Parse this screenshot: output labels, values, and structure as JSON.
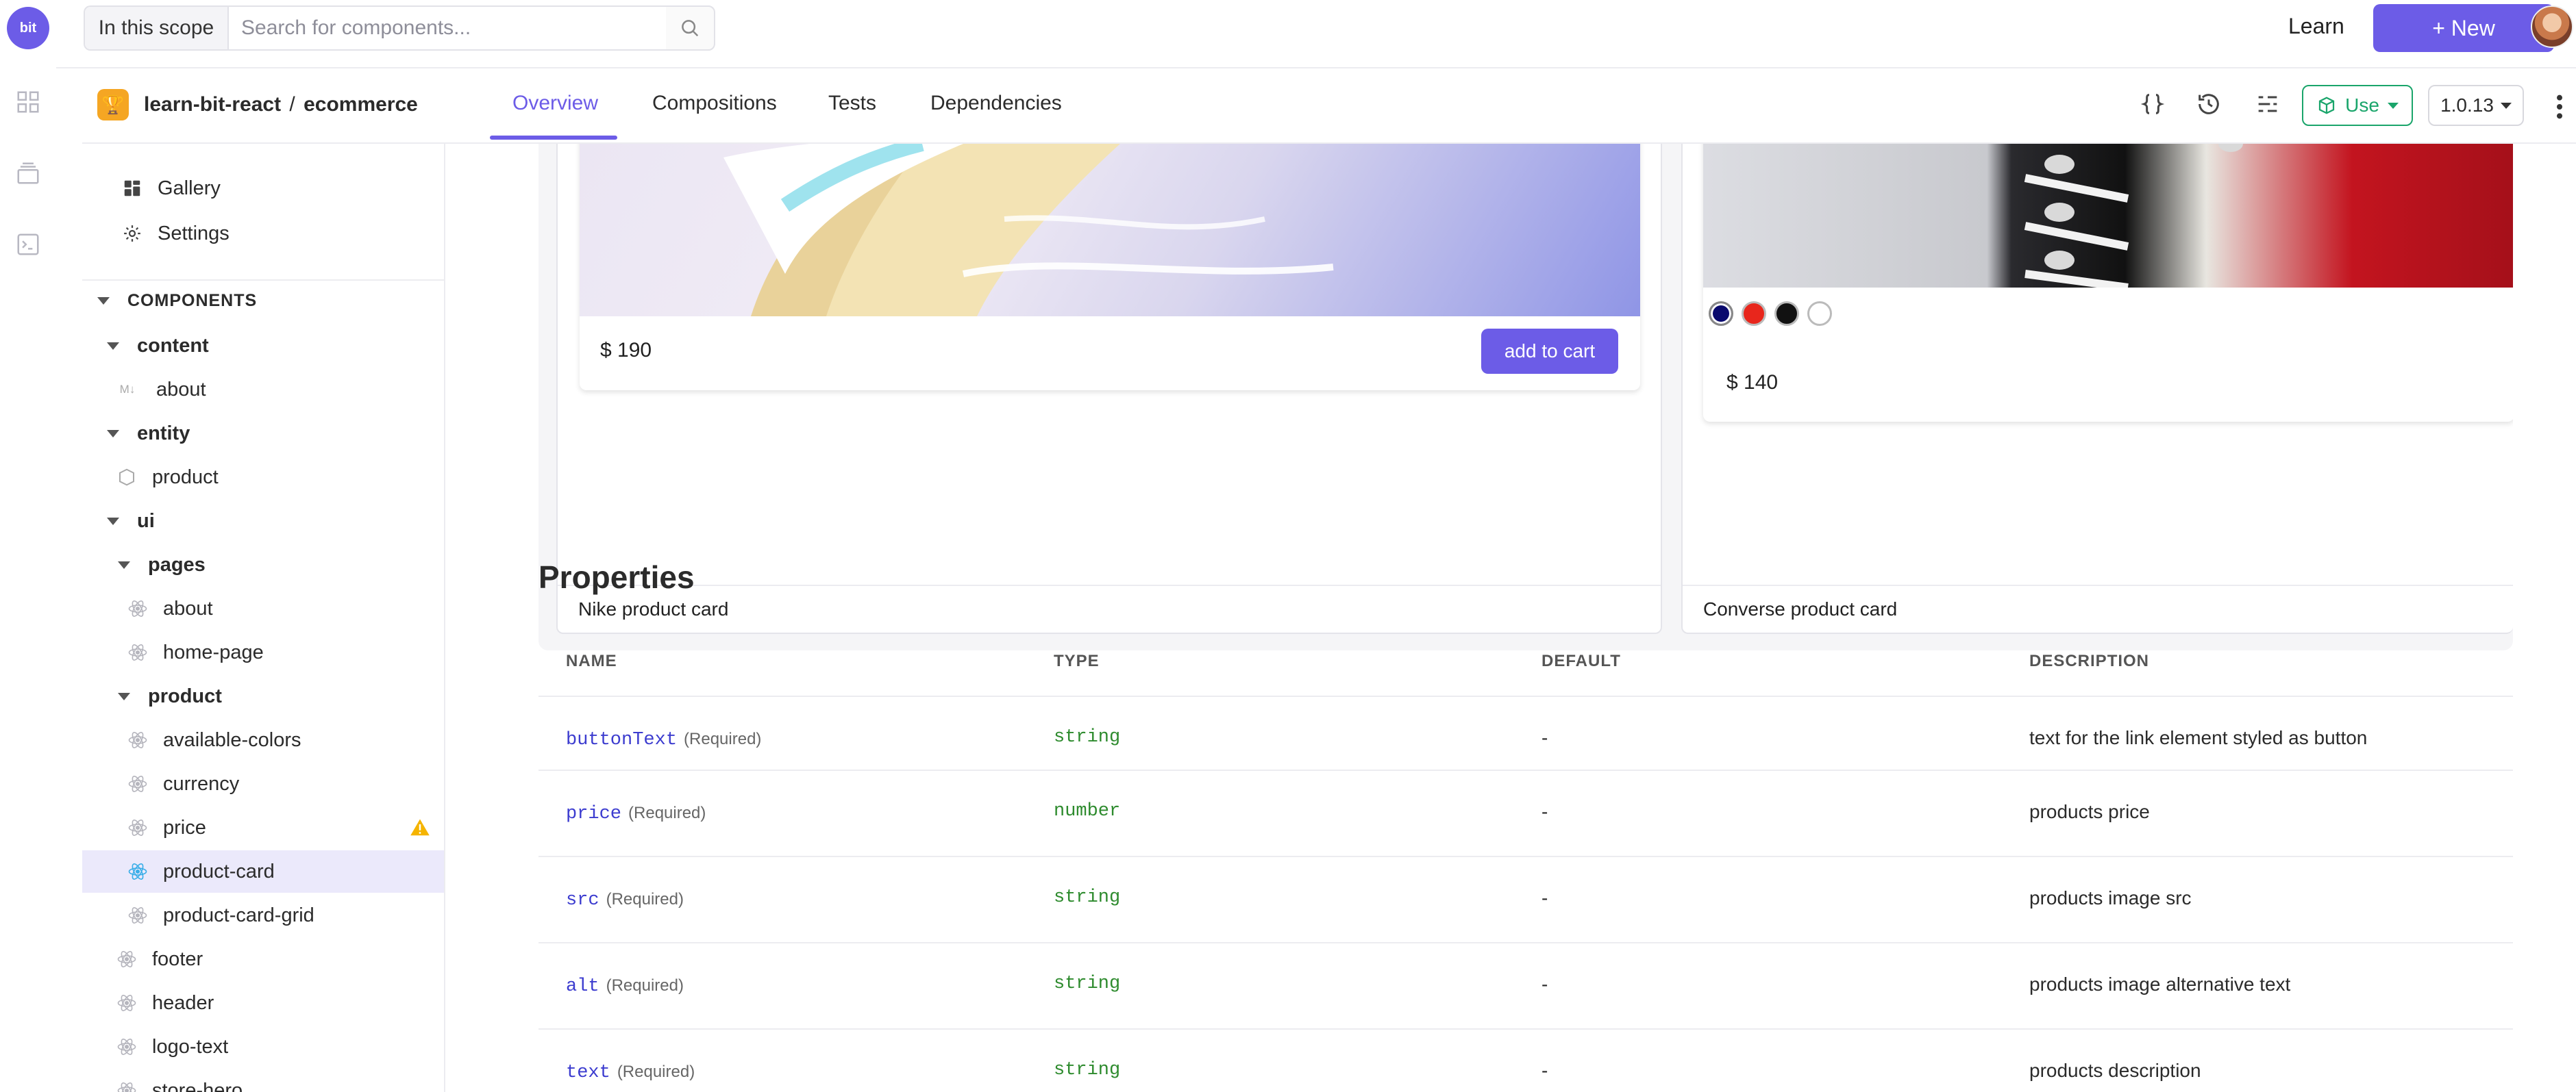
{
  "rail": {
    "logo": "bit"
  },
  "topbar": {
    "scope_label": "In this scope",
    "search_placeholder": "Search for components...",
    "learn": "Learn",
    "new_button": "+ New"
  },
  "component": {
    "scope": "learn-bit-react",
    "separator": "/",
    "name": "ecommerce",
    "tabs": [
      "Overview",
      "Compositions",
      "Tests",
      "Dependencies"
    ],
    "active_tab": "Overview",
    "use_button": "Use",
    "version": "1.0.13"
  },
  "sidebar": {
    "gallery": "Gallery",
    "settings": "Settings",
    "components_header": "COMPONENTS",
    "tree": {
      "content": "content",
      "about_md": "about",
      "entity": "entity",
      "product_entity": "product",
      "ui": "ui",
      "pages": "pages",
      "pages_about": "about",
      "home_page": "home-page",
      "product_ns": "product",
      "available_colors": "available-colors",
      "currency": "currency",
      "price": "price",
      "product_card": "product-card",
      "product_card_grid": "product-card-grid",
      "footer": "footer",
      "header": "header",
      "logo_text": "logo-text",
      "store_hero": "store-hero"
    }
  },
  "compositions": {
    "nike": {
      "price": "$ 190",
      "button": "add to cart",
      "caption": "Nike product card"
    },
    "converse": {
      "price": "$ 140",
      "caption": "Converse product card",
      "swatches": [
        "#0a0a6e",
        "#e8261c",
        "#111111",
        "#ffffff"
      ]
    }
  },
  "properties": {
    "title": "Properties",
    "headers": {
      "name": "NAME",
      "type": "TYPE",
      "default": "DEFAULT",
      "description": "DESCRIPTION"
    },
    "rows": [
      {
        "name": "buttonText",
        "required": "(Required)",
        "type": "string",
        "default": "-",
        "description": "text for the link element styled as button"
      },
      {
        "name": "price",
        "required": "(Required)",
        "type": "number",
        "default": "-",
        "description": "products price"
      },
      {
        "name": "src",
        "required": "(Required)",
        "type": "string",
        "default": "-",
        "description": "products image src"
      },
      {
        "name": "alt",
        "required": "(Required)",
        "type": "string",
        "default": "-",
        "description": "products image alternative text"
      },
      {
        "name": "text",
        "required": "(Required)",
        "type": "string",
        "default": "-",
        "description": "products description"
      }
    ]
  },
  "colors": {
    "accent": "#6c5ce7",
    "use_green": "#1aa56b",
    "warning": "#f5b400"
  }
}
